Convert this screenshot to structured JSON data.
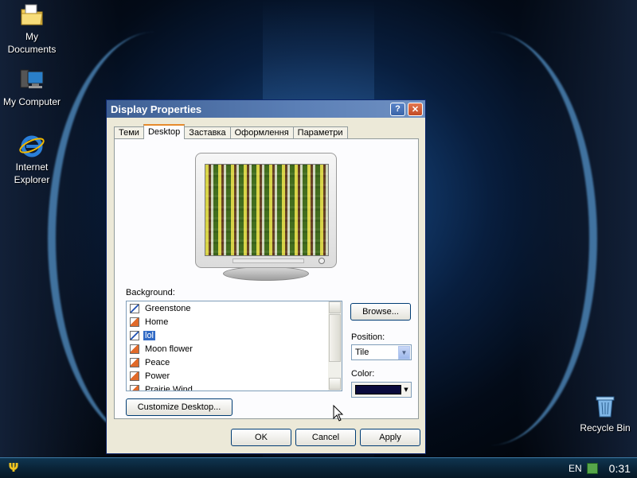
{
  "desktop": {
    "icons": [
      {
        "label": "My\nDocuments",
        "icon": "folder-documents-icon"
      },
      {
        "label": "My Computer",
        "icon": "computer-icon"
      },
      {
        "label": "Internet\nExplorer",
        "icon": "internet-explorer-icon"
      },
      {
        "label": "Recycle Bin",
        "icon": "recycle-bin-icon"
      }
    ]
  },
  "window": {
    "title": "Display Properties",
    "help_glyph": "?",
    "close_glyph": "✕",
    "tabs": [
      {
        "label": "Теми",
        "active": false
      },
      {
        "label": "Desktop",
        "active": true
      },
      {
        "label": "Заставка",
        "active": false
      },
      {
        "label": "Оформлення",
        "active": false
      },
      {
        "label": "Параметри",
        "active": false
      }
    ],
    "background_label": "Background:",
    "background_list": [
      {
        "label": "Greenstone",
        "type": "image"
      },
      {
        "label": "Home",
        "type": "image"
      },
      {
        "label": "lol",
        "type": "image",
        "selected": true
      },
      {
        "label": "Moon flower",
        "type": "image"
      },
      {
        "label": "Peace",
        "type": "image"
      },
      {
        "label": "Power",
        "type": "image"
      },
      {
        "label": "Prairie Wind",
        "type": "image"
      }
    ],
    "browse_label": "Browse...",
    "position_label": "Position:",
    "position_value": "Tile",
    "color_label": "Color:",
    "color_value": "#0a0a3c",
    "customize_label": "Customize Desktop...",
    "ok_label": "OK",
    "cancel_label": "Cancel",
    "apply_label": "Apply"
  },
  "taskbar": {
    "start_glyph": "Ψ",
    "language": "EN",
    "clock": "0:31"
  }
}
